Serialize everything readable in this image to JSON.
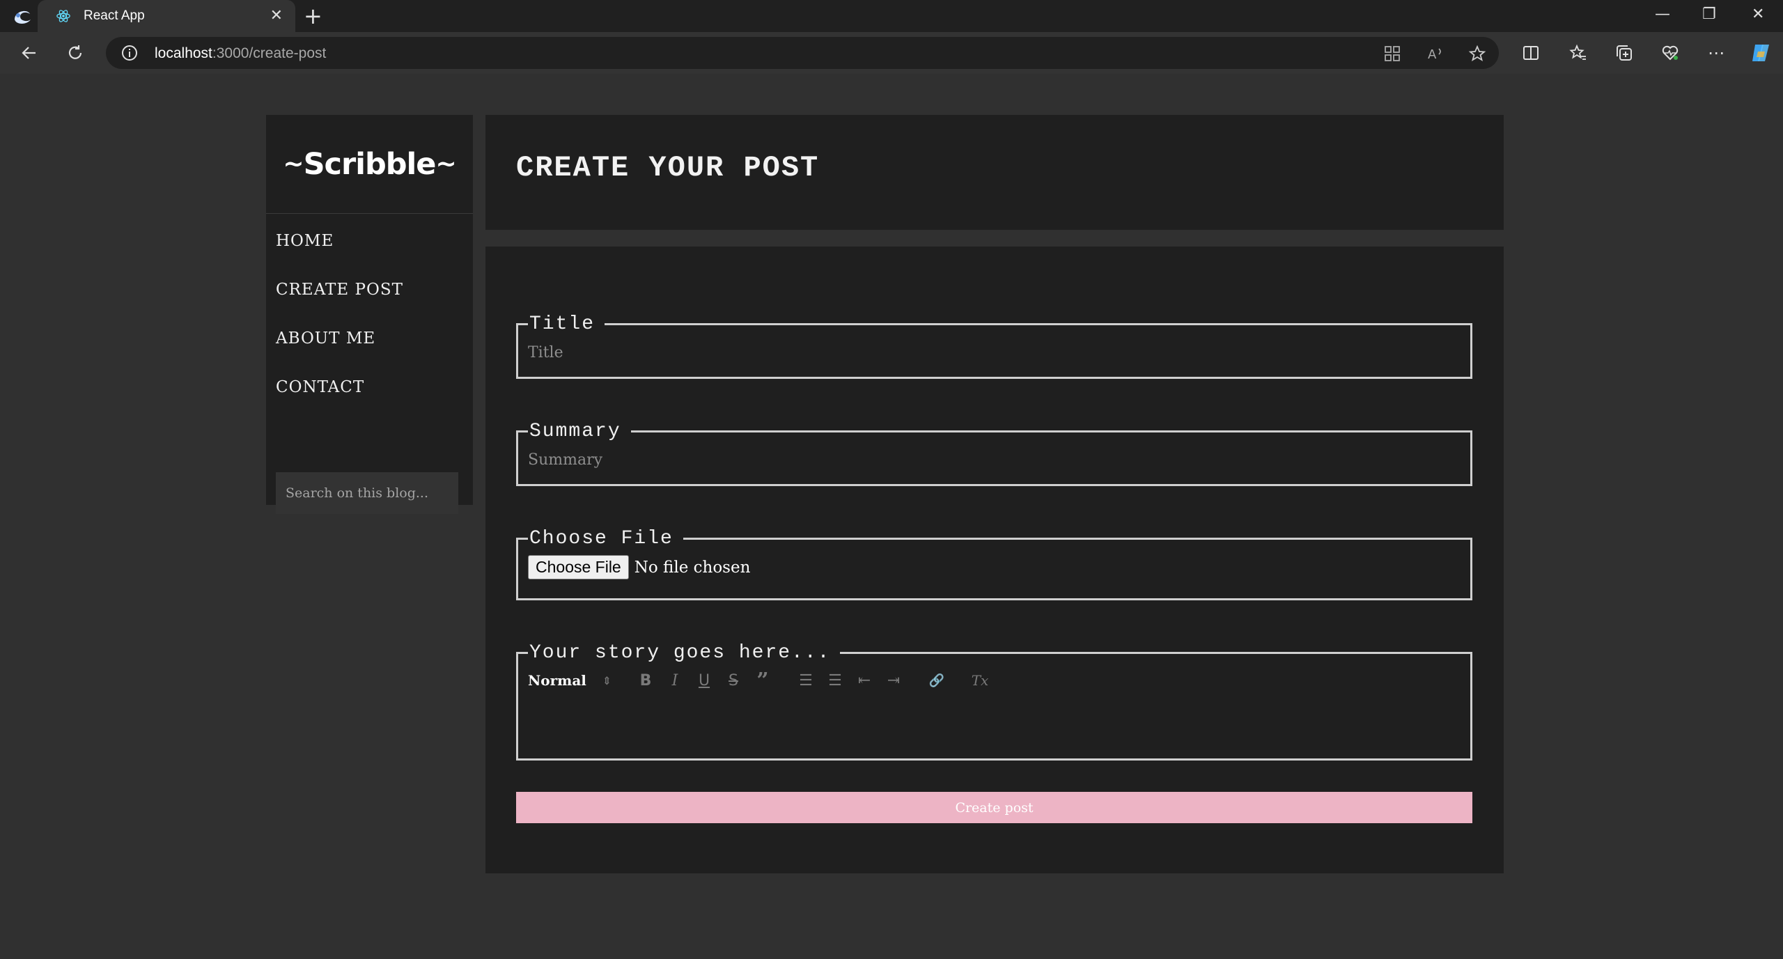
{
  "browser": {
    "tab_title": "React App",
    "tab_close": "✕",
    "new_tab": "+",
    "url_host": "localhost",
    "url_path": ":3000/create-post",
    "window_controls": {
      "minimize": "—",
      "restore": "❐",
      "close": "✕"
    },
    "more_label": "⋯"
  },
  "sidebar": {
    "logo": "Scribble",
    "nav": [
      {
        "label": "HOME"
      },
      {
        "label": "CREATE POST"
      },
      {
        "label": "ABOUT ME"
      },
      {
        "label": "CONTACT"
      }
    ],
    "search_placeholder": "Search on this blog..."
  },
  "header": {
    "title": "CREATE YOUR POST"
  },
  "form": {
    "title_legend": "Title",
    "title_placeholder": "Title",
    "summary_legend": "Summary",
    "summary_placeholder": "Summary",
    "file_legend": "Choose File",
    "file_button": "Choose File",
    "file_status": "No file chosen",
    "story_legend": "Your story goes here...",
    "editor": {
      "format": "Normal",
      "format_arrows": "⇕",
      "bold": "B",
      "italic": "I",
      "underline": "U",
      "strike": "S",
      "quote": "”",
      "ordered_list": "☰",
      "bullet_list": "☰",
      "outdent": "⇤",
      "indent": "⇥",
      "link": "🔗",
      "clean": "Tx"
    },
    "submit": "Create post"
  },
  "colors": {
    "page_bg": "#303030",
    "panel_bg": "#1f1f1f",
    "accent_button": "#edb4c5",
    "border": "#cfcfcf"
  }
}
